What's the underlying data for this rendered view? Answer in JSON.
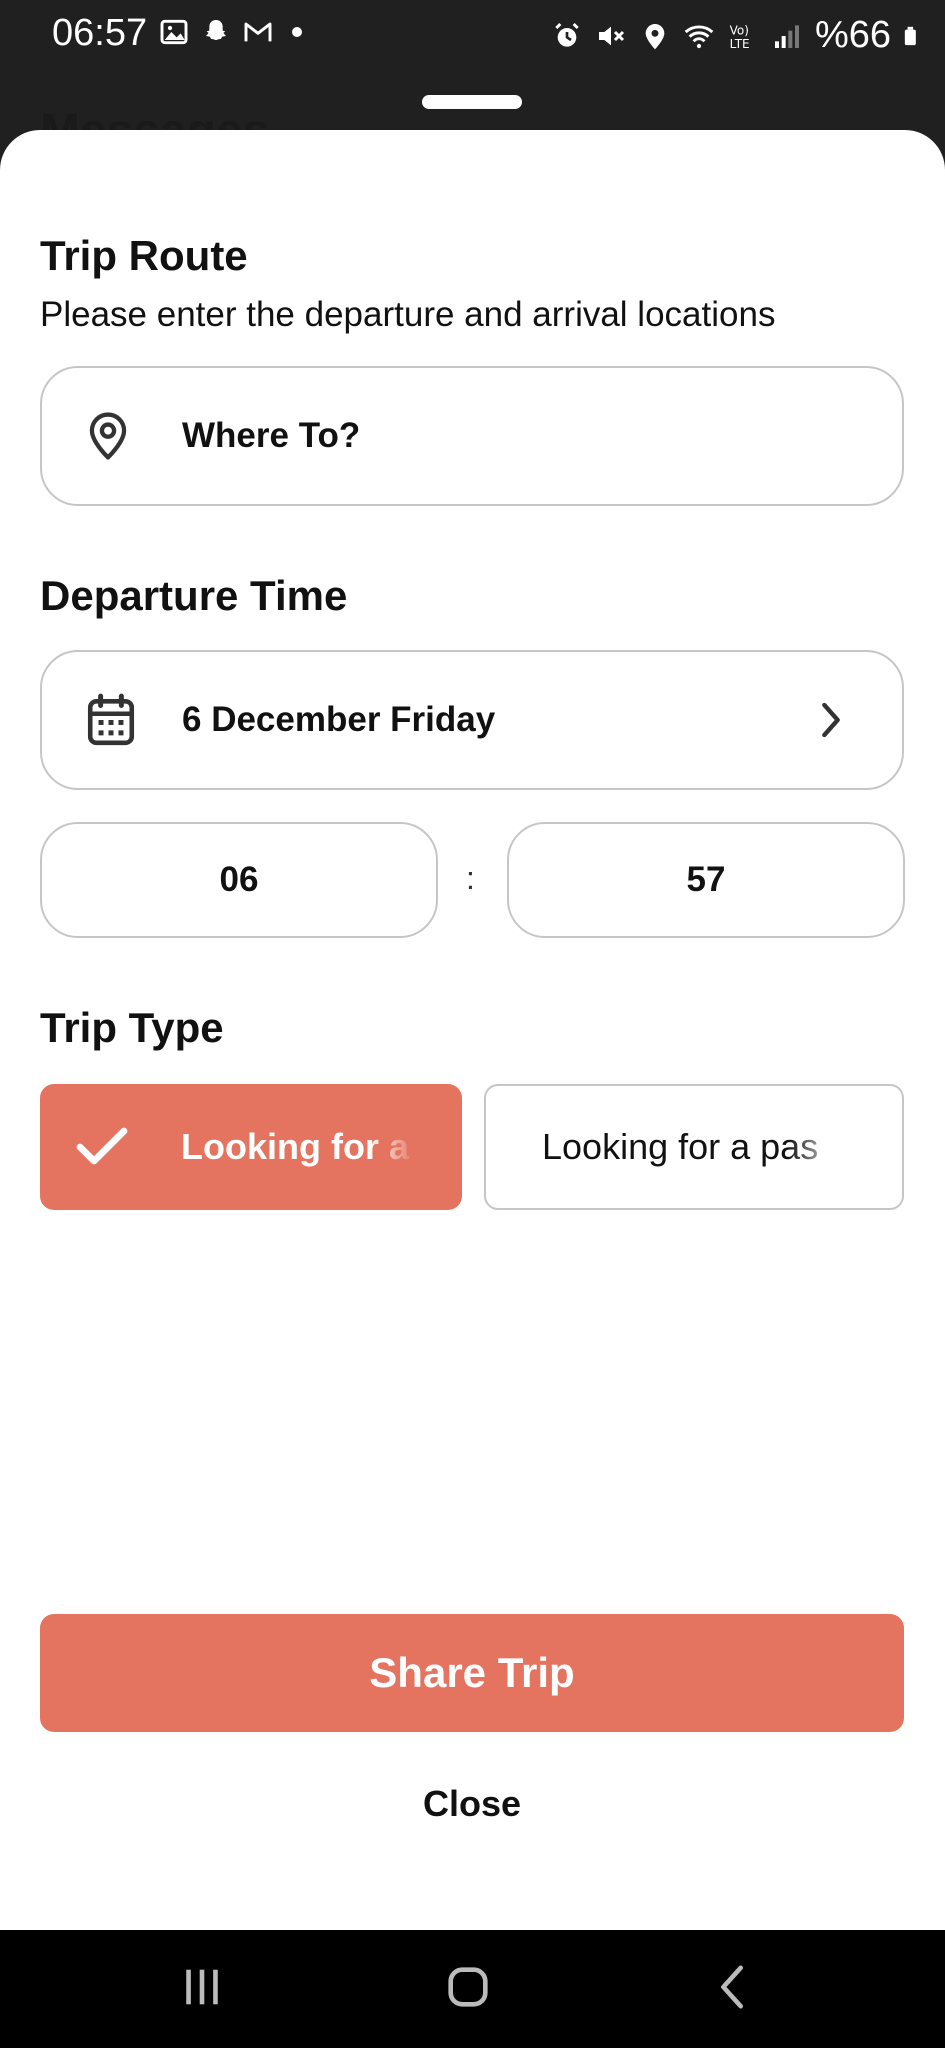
{
  "status_bar": {
    "time": "06:57",
    "battery": "%66",
    "left_icons": [
      "image-icon",
      "snapchat-icon",
      "gmail-icon",
      "notification-dot"
    ],
    "right_icons": [
      "alarm-icon",
      "mute-icon",
      "location-icon",
      "wifi-icon",
      "volte-icon",
      "signal-icon",
      "battery-icon"
    ]
  },
  "background_app": {
    "title": "Messages"
  },
  "sheet": {
    "route_title": "Trip Route",
    "route_subtitle": "Please enter the departure and arrival locations",
    "destination_placeholder": "Where To?",
    "departure_title": "Departure Time",
    "date_value": "6 December Friday",
    "hour": "06",
    "separator": ":",
    "minute": "57",
    "trip_type_title": "Trip Type",
    "trip_types": [
      {
        "label": "Looking for a",
        "selected": true
      },
      {
        "label": "Looking for a pas",
        "selected": false
      }
    ],
    "share_label": "Share Trip",
    "close_label": "Close"
  },
  "colors": {
    "accent": "#e4735f",
    "border": "#c6c6c6",
    "status_bar_bg": "#202020",
    "nav_bar_bg": "#000000"
  }
}
